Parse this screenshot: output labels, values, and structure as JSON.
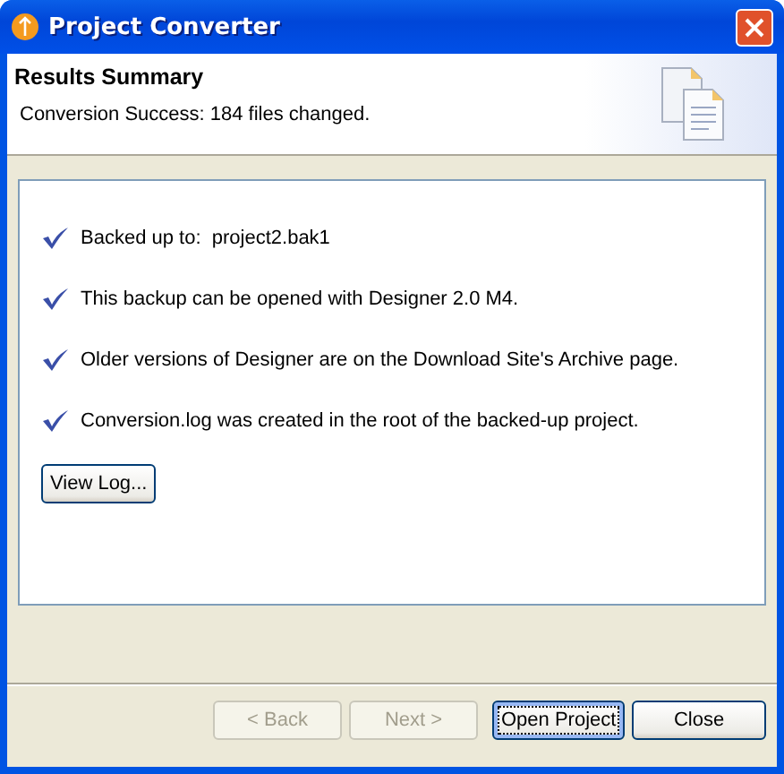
{
  "window": {
    "title": "Project Converter"
  },
  "header": {
    "title": "Results Summary",
    "subtitle": "Conversion Success: 184 files changed."
  },
  "results": [
    {
      "text": "Backed up to:  project2.bak1",
      "checked": true
    },
    {
      "text": "This backup can be opened with Designer 2.0 M4.",
      "checked": true
    },
    {
      "text": "Older versions of Designer are on the Download Site's Archive page.",
      "checked": true
    },
    {
      "text": "Conversion.log was created in the root of the backed-up project.",
      "checked": true
    }
  ],
  "view_log_button": "View Log...",
  "buttons": [
    {
      "label": "< Back",
      "disabled": true,
      "focused": false
    },
    {
      "label": "Next >",
      "disabled": true,
      "focused": false
    },
    {
      "label": "Open Project",
      "disabled": false,
      "focused": true
    },
    {
      "label": "Close",
      "disabled": false,
      "focused": false
    }
  ]
}
